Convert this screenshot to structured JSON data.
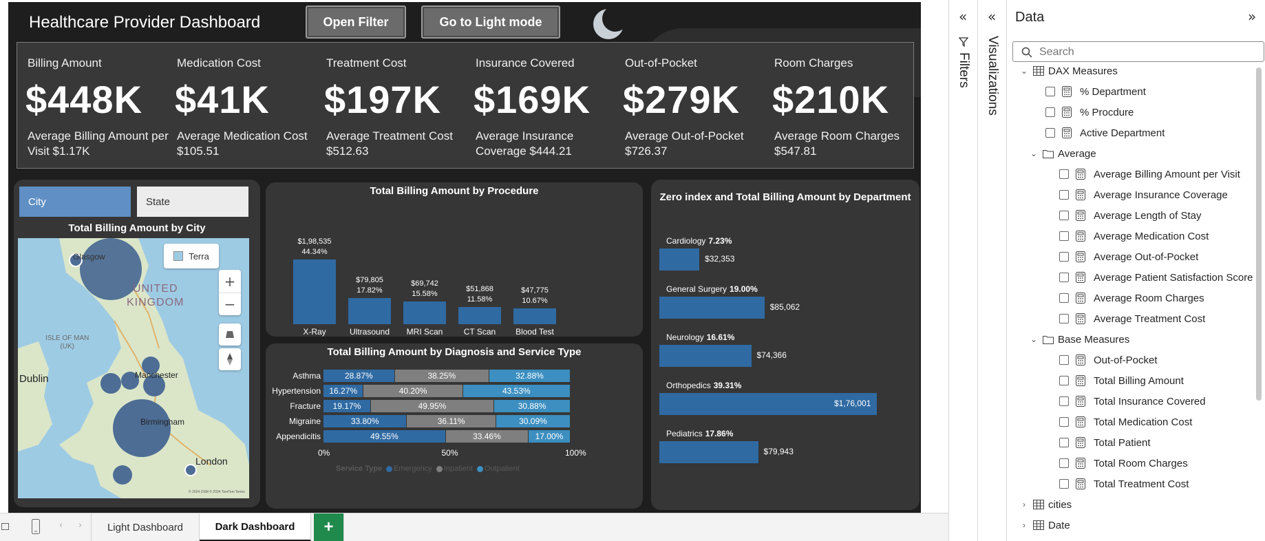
{
  "report": {
    "title": "Healthcare Provider Dashboard",
    "open_filter_label": "Open Filter",
    "light_mode_label": "Go to Light mode"
  },
  "kpis": [
    {
      "label": "Billing Amount",
      "value": "$448K",
      "sub": "Average Billing Amount per Visit $1.17K"
    },
    {
      "label": "Medication Cost",
      "value": "$41K",
      "sub": "Average Medication Cost $105.51"
    },
    {
      "label": "Treatment Cost",
      "value": "$197K",
      "sub": "Average Treatment Cost $512.63"
    },
    {
      "label": "Insurance Covered",
      "value": "$169K",
      "sub": "Average Insurance Coverage $444.21"
    },
    {
      "label": "Out-of-Pocket",
      "value": "$279K",
      "sub": "Average Out-of-Pocket $726.37"
    },
    {
      "label": "Room Charges",
      "value": "$210K",
      "sub": "Average Room Charges $547.81"
    }
  ],
  "city_panel": {
    "btn_city": "City",
    "btn_state": "State",
    "title": "Total Billing Amount by City",
    "map_style_label": "Terra",
    "places": {
      "glasgow": "Glasgow",
      "uk_line1": "UNITED",
      "uk_line2": "KINGDOM",
      "isle_line1": "ISLE OF MAN",
      "isle_line2": "(UK)",
      "dublin": "Dublin",
      "manchester": "Manchester",
      "birmingham": "Birmingham",
      "london": "London"
    },
    "zoom_in": "+",
    "zoom_out": "−",
    "copyright": "© 2024 OSM © 2024 TomTom Terms"
  },
  "chart_data": [
    {
      "type": "bar",
      "title": "Total Billing Amount by Procedure",
      "categories": [
        "X-Ray",
        "Ultrasound",
        "MRI Scan",
        "CT Scan",
        "Blood Test"
      ],
      "values": [
        198535,
        79805,
        69742,
        51868,
        47775
      ],
      "value_labels": [
        "$1,98,535",
        "$79,805",
        "$69,742",
        "$51,868",
        "$47,775"
      ],
      "pct_labels": [
        "44.34%",
        "17.82%",
        "15.58%",
        "11.58%",
        "10.67%"
      ],
      "color": "#2f6aa3"
    },
    {
      "type": "bar",
      "title": "Total Billing Amount by Diagnosis and Service Type",
      "orientation": "horizontal-100%-stacked",
      "categories": [
        "Asthma",
        "Hypertension",
        "Fracture",
        "Migraine",
        "Appendicitis"
      ],
      "series": [
        {
          "name": "Emergency",
          "color": "#2f6aa3",
          "values": [
            28.87,
            16.27,
            19.17,
            33.8,
            49.55
          ],
          "labels": [
            "28.87%",
            "16.27%",
            "19.17%",
            "33.80%",
            "49.55%"
          ]
        },
        {
          "name": "Inpatient",
          "color": "#7f7f7f",
          "values": [
            38.25,
            40.2,
            49.95,
            36.11,
            33.46
          ],
          "labels": [
            "38.25%",
            "40.20%",
            "49.95%",
            "36.11%",
            "33.46%"
          ]
        },
        {
          "name": "Outpatient",
          "color": "#3c8fc0",
          "values": [
            32.88,
            43.53,
            30.88,
            30.09,
            17.0
          ],
          "labels": [
            "32.88%",
            "43.53%",
            "30.88%",
            "30.09%",
            "17.00%"
          ]
        }
      ],
      "xticks": [
        "0%",
        "50%",
        "100%"
      ],
      "legend_title": "Service Type"
    },
    {
      "type": "bar",
      "orientation": "horizontal",
      "title": "Zero index and Total Billing Amount by Department",
      "categories": [
        "Cardiology",
        "General Surgery",
        "Neurology",
        "Orthopedics",
        "Pediatrics"
      ],
      "pct_labels": [
        "7.23%",
        "19.00%",
        "16.61%",
        "39.31%",
        "17.86%"
      ],
      "values": [
        32353,
        85062,
        74366,
        176001,
        79943
      ],
      "value_labels": [
        "$32,353",
        "$85,062",
        "$74,366",
        "$1,76,001",
        "$79,943"
      ],
      "color": "#2f6aa3"
    }
  ],
  "tabs": {
    "light": "Light Dashboard",
    "dark": "Dark Dashboard",
    "add": "+"
  },
  "panes": {
    "filters": "Filters",
    "visualizations": "Visualizations",
    "data_title": "Data",
    "search_placeholder": "Search"
  },
  "data_tree": {
    "dax": "DAX Measures",
    "top_items": [
      "% Department",
      "% Procdure",
      "Active Department"
    ],
    "average_folder": "Average",
    "average_items": [
      "Average Billing Amount per Visit",
      "Average Insurance Coverage",
      "Average Length of Stay",
      "Average Medication Cost",
      "Average Out-of-Pocket",
      "Average Patient Satisfaction Score",
      "Average Room Charges",
      "Average Treatment Cost"
    ],
    "base_folder": "Base Measures",
    "base_items": [
      "Out-of-Pocket",
      "Total Billing Amount",
      "Total Insurance Covered",
      "Total Medication Cost",
      "Total Patient",
      "Total Room Charges",
      "Total Treatment Cost"
    ],
    "tables": [
      "cities",
      "Date"
    ]
  }
}
